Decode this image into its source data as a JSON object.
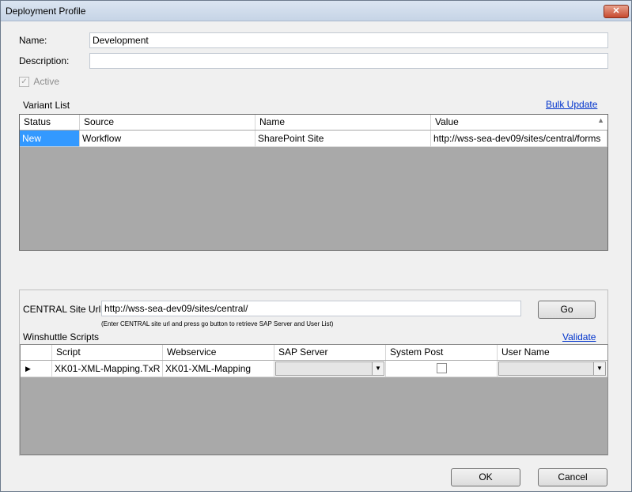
{
  "window": {
    "title": "Deployment Profile",
    "close_glyph": "✕"
  },
  "form": {
    "name_label": "Name:",
    "name_value": "Development",
    "description_label": "Description:",
    "description_value": "",
    "active_label": "Active",
    "active_checked": true
  },
  "variant_list": {
    "label": "Variant List",
    "bulk_update": "Bulk Update",
    "columns": [
      "Status",
      "Source",
      "Name",
      "Value"
    ],
    "rows": [
      {
        "status": "New",
        "source": "Workflow",
        "name": "SharePoint Site",
        "value": "http://wss-sea-dev09/sites/central/forms"
      }
    ]
  },
  "central": {
    "label": "CENTRAL Site Url :",
    "url": "http://wss-sea-dev09/sites/central/",
    "go": "Go",
    "hint": "(Enter CENTRAL site url and press go button to retrieve SAP Server and User List)"
  },
  "scripts": {
    "label": "Winshuttle Scripts",
    "validate": "Validate",
    "columns": [
      "Script",
      "Webservice",
      "SAP Server",
      "System Post",
      "User Name"
    ],
    "rows": [
      {
        "indicator": "▶",
        "script": "XK01-XML-Mapping.TxR",
        "webservice": "XK01-XML-Mapping",
        "sap_server": "",
        "system_post": false,
        "user_name": ""
      }
    ]
  },
  "footer": {
    "ok": "OK",
    "cancel": "Cancel"
  },
  "icons": {
    "sort": "▲",
    "dropdown": "▼",
    "check": "✓"
  }
}
